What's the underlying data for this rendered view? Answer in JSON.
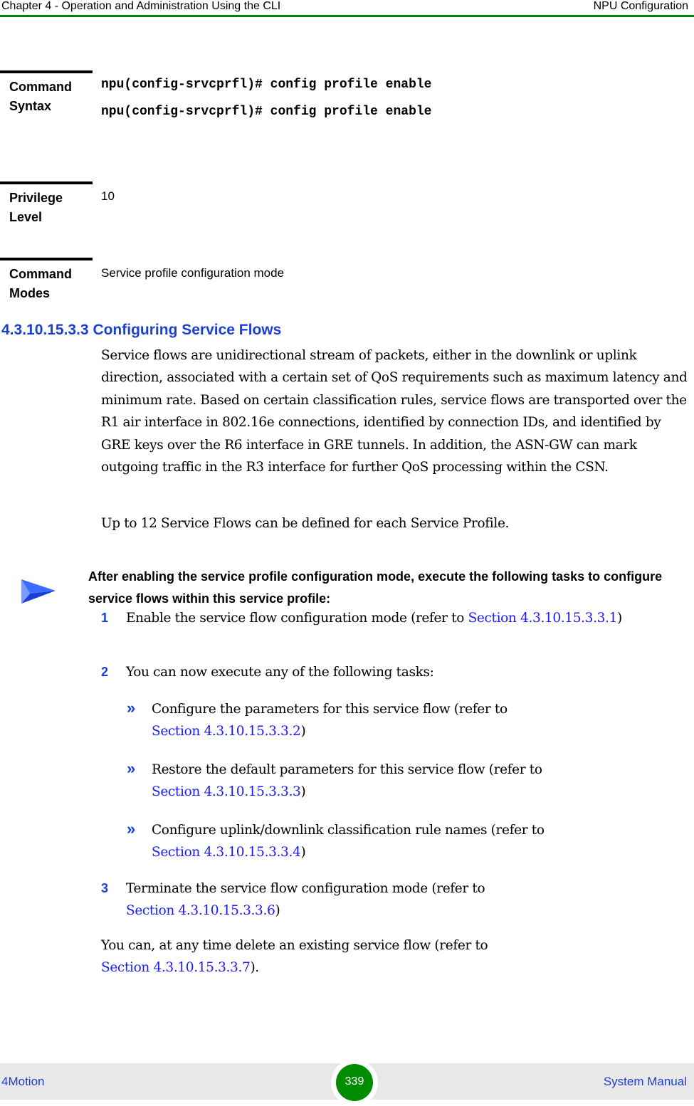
{
  "header": {
    "chapter": "Chapter 4 - Operation and Administration Using the CLI",
    "section": "NPU Configuration",
    "rule_color": "#008000"
  },
  "command_syntax": {
    "label_line1": "Command",
    "label_line2": "Syntax",
    "lines": [
      "npu(config-srvcprfl)# config profile enable",
      "npu(config-srvcprfl)# config profile enable"
    ]
  },
  "privilege_level": {
    "label_line1": "Privilege",
    "label_line2": "Level",
    "value": "10"
  },
  "command_modes": {
    "label_line1": "Command",
    "label_line2": "Modes",
    "value": "Service profile configuration mode"
  },
  "section": {
    "heading": "4.3.10.15.3.3 Configuring Service Flows",
    "para1": "Service flows are unidirectional stream of packets, either in the downlink or uplink direction, associated with a certain set of QoS requirements such as maximum latency and minimum rate. Based on certain classification rules, service flows are transported over the R1 air interface in 802.16e connections, identified by connection IDs, and identified by GRE keys over the R6 interface in GRE tunnels. In addition, the ASN-GW can mark outgoing traffic in the R3 interface for further QoS processing within the CSN.",
    "para2": "Up to 12 Service Flows can be defined for each Service Profile.",
    "note_icon": "arrow-right-icon",
    "note": "After enabling the service profile configuration mode, execute the following tasks to configure service flows within this service profile:"
  },
  "steps": [
    {
      "num": "1",
      "text": "Enable the service flow configuration mode (refer to ",
      "link": "Section 4.3.10.15.3.3.1",
      "after": ")"
    },
    {
      "num": "2",
      "text": "You can now execute any of the following tasks:"
    },
    {
      "num": "3",
      "text": "Terminate the service flow configuration mode (refer to ",
      "link": "Section 4.3.10.15.3.3.6",
      "after": ")"
    }
  ],
  "subtasks": [
    {
      "bullet": "»",
      "text": "Configure the parameters for this service flow (refer to ",
      "link": "Section 4.3.10.15.3.3.2",
      "after": ")"
    },
    {
      "bullet": "»",
      "text": "Restore the default parameters for this service flow (refer to ",
      "link": "Section 4.3.10.15.3.3.3",
      "after": ")"
    },
    {
      "bullet": "»",
      "text": "Configure uplink/downlink classification rule names (refer to ",
      "link": "Section 4.3.10.15.3.3.4",
      "after": ")"
    }
  ],
  "closing": {
    "text": "You can, at any time delete an existing service flow (refer to ",
    "link": "Section 4.3.10.15.3.3.7",
    "after": ")."
  },
  "footer": {
    "product": "4Motion",
    "page": "339",
    "manual": "System Manual",
    "badge_color": "#008c00"
  }
}
